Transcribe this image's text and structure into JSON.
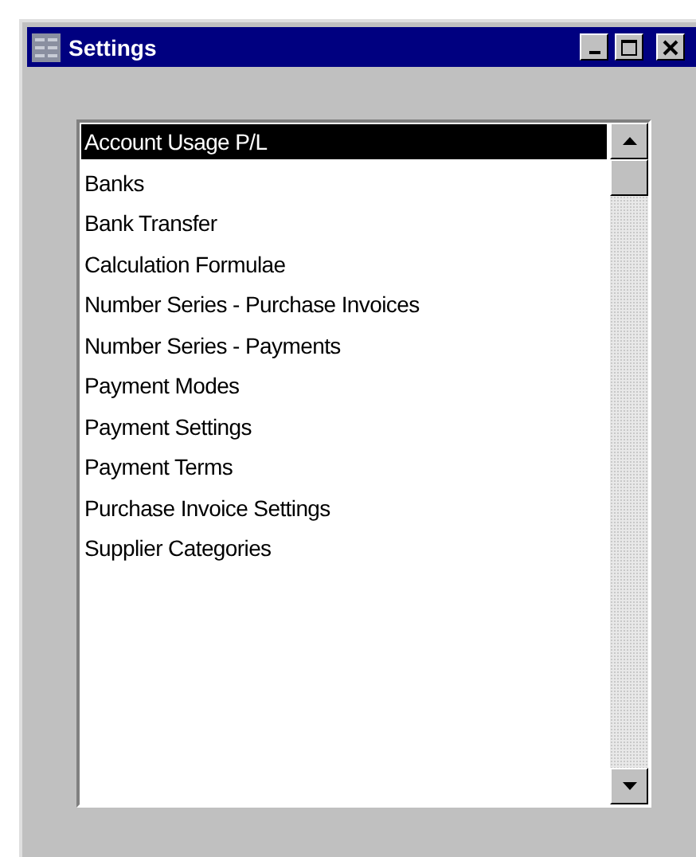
{
  "window": {
    "title": "Settings"
  },
  "list": {
    "items": [
      {
        "label": "Account Usage P/L",
        "selected": true
      },
      {
        "label": "Banks",
        "selected": false
      },
      {
        "label": "Bank Transfer",
        "selected": false
      },
      {
        "label": "Calculation Formulae",
        "selected": false
      },
      {
        "label": "Number Series - Purchase Invoices",
        "selected": false
      },
      {
        "label": "Number Series - Payments",
        "selected": false
      },
      {
        "label": "Payment Modes",
        "selected": false
      },
      {
        "label": "Payment Settings",
        "selected": false
      },
      {
        "label": "Payment Terms",
        "selected": false
      },
      {
        "label": "Purchase Invoice Settings",
        "selected": false
      },
      {
        "label": "Supplier Categories",
        "selected": false
      }
    ]
  }
}
